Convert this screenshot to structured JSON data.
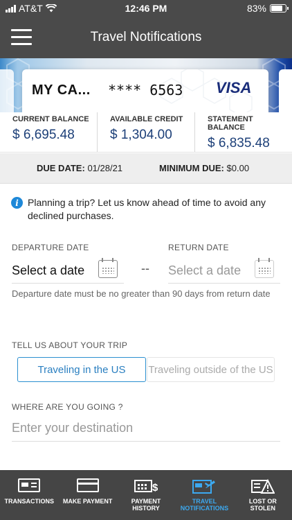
{
  "status_bar": {
    "carrier": "AT&T",
    "time": "12:46 PM",
    "battery": "83%"
  },
  "header": {
    "title": "Travel Notifications"
  },
  "card": {
    "name": "MY CA...",
    "number": "**** 6563",
    "brand": "VISA"
  },
  "balances": [
    {
      "label": "CURRENT BALANCE",
      "value": "$ 6,695.48"
    },
    {
      "label": "AVAILABLE CREDIT",
      "value": "$ 1,304.00"
    },
    {
      "label": "STATEMENT BALANCE",
      "value": "$ 6,835.48"
    }
  ],
  "due": {
    "due_label": "DUE DATE:",
    "due_value": "01/28/21",
    "min_label": "MINIMUM DUE:",
    "min_value": "$0.00"
  },
  "info": {
    "text": "Planning a trip? Let us know ahead of time to avoid any declined purchases."
  },
  "dates": {
    "departure_label": "DEPARTURE DATE",
    "departure_value": "Select a date",
    "separator": "--",
    "return_label": "RETURN DATE",
    "return_value": "Select a date",
    "hint": "Departure date must be no greater than 90 days from return date"
  },
  "trip": {
    "label": "TELL US ABOUT YOUR TRIP",
    "options": [
      "Traveling in the US",
      "Traveling outside of the US"
    ],
    "selected": "Traveling in the US"
  },
  "destination": {
    "label": "WHERE ARE YOU GOING ?",
    "placeholder": "Enter your destination"
  },
  "tabs": [
    {
      "label": "TRANSACTIONS",
      "icon": "card-list-icon"
    },
    {
      "label": "MAKE PAYMENT",
      "icon": "card-icon"
    },
    {
      "label": "PAYMENT HISTORY",
      "icon": "payment-history-icon"
    },
    {
      "label": "TRAVEL NOTIFICATIONS",
      "icon": "travel-card-icon",
      "active": true
    },
    {
      "label": "LOST OR STOLEN",
      "icon": "lost-card-warning-icon"
    }
  ],
  "colors": {
    "accent": "#2a8fd0",
    "header_bg": "#4a4a4a",
    "tabbar_bg": "#454545",
    "balance_text": "#1c3f78"
  }
}
